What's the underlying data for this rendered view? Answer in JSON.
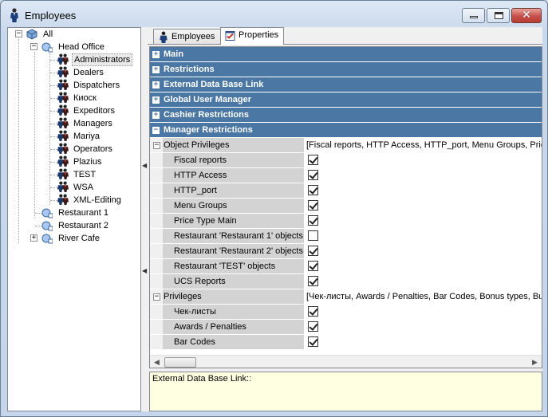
{
  "window": {
    "title": "Employees"
  },
  "tree": {
    "root": "All",
    "nodes": [
      {
        "label": "Head Office",
        "children": [
          "Administrators",
          "Dealers",
          "Dispatchers",
          "Киоск",
          "Expeditors",
          "Managers",
          "Mariya",
          "Operators",
          "Plazius",
          "TEST",
          "WSA",
          "XML-Editing"
        ]
      },
      {
        "label": "Restaurant 1"
      },
      {
        "label": "Restaurant 2"
      },
      {
        "label": "River Cafe"
      }
    ],
    "selected": "Administrators"
  },
  "tabs": [
    {
      "label": "Employees"
    },
    {
      "label": "Properties"
    }
  ],
  "categories": [
    "Main",
    "Restrictions",
    "External Data Base Link",
    "Global User Manager",
    "Cashier Restrictions",
    "Manager Restrictions"
  ],
  "groups": {
    "object_privileges": {
      "label": "Object Privileges",
      "summary": "[Fiscal reports, HTTP Access, HTTP_port, Menu Groups, Price",
      "items": [
        {
          "label": "Fiscal reports",
          "checked": true
        },
        {
          "label": "HTTP Access",
          "checked": true
        },
        {
          "label": "HTTP_port",
          "checked": true
        },
        {
          "label": "Menu Groups",
          "checked": true
        },
        {
          "label": "Price Type Main",
          "checked": true
        },
        {
          "label": "Restaurant 'Restaurant 1' objects",
          "checked": false
        },
        {
          "label": "Restaurant 'Restaurant 2' objects",
          "checked": true
        },
        {
          "label": "Restaurant 'TEST' objects",
          "checked": true
        },
        {
          "label": "UCS Reports",
          "checked": true
        }
      ]
    },
    "privileges": {
      "label": "Privileges",
      "summary": "[Чек-листы, Awards / Penalties, Bar Codes, Bonus types, Bus",
      "items": [
        {
          "label": "Чек-листы",
          "checked": true
        },
        {
          "label": "Awards / Penalties",
          "checked": true
        },
        {
          "label": "Bar Codes",
          "checked": true
        }
      ]
    }
  },
  "description": "External Data Base Link::",
  "colors": {
    "category_bg": "#4a77a4",
    "label_bg": "#d3d3d3",
    "desc_bg": "#ffffe1"
  }
}
